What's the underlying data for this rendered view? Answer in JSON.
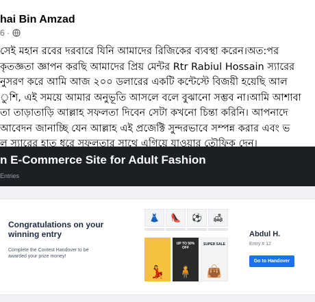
{
  "post": {
    "author": "hai Bin Amzad",
    "time": "6 ·",
    "globe_icon": "globe-icon",
    "lines": [
      "সেই মহান রবের দরবারে যিনি আমাদের রিজিকের ব্যবস্থা করেন।অত:পর",
      "কৃতজ্ঞতা জ্ঞাপন করছি আমাদের প্রিয় মেন্টর Rtr Rabiul Hossain স্যারের",
      "নুসরণ করে আমি আজ ২০০ ডলারের একটি কন্টেস্টে বিজয়ী হয়েছি আল",
      "ুশি, এই সময়ে আমার অনুভূতি আসলে বলে বুঝানো সম্ভব না।আমি আশাবা",
      "তা তাড়াতাড়ি আল্লাহ সফলতা দিবেন সেটা কখনো চিন্তা করিনি। আপনাদে",
      "আবেদন জানাচ্ছি যেন আল্লাহ এই প্রজেক্টি সুন্দরভাবে সম্পন্ন করার  এবং ভ",
      "ল স্যারের হাত ধরে সফলতার সাথে এগিয়ে যাওয়ার তৌফিক দেন।"
    ]
  },
  "attachment": {
    "banner_title": "n E-Commerce Site for Adult Fashion",
    "banner_sub": "Entries",
    "congrats_title": "Congratulations on your winning entry",
    "congrats_sub": "Complete the Contest Handover to be awarded your prize money!",
    "winner_name": "Abdul H.",
    "winner_entry": "Entry # 12",
    "handover_button": "Go to Handover",
    "promo": {
      "p2_text": "UP TO 50% OFF",
      "p3_text": "SUPER SALE"
    }
  },
  "colors": {
    "banner_bg": "#1c1f24",
    "button_blue": "#1a73e8"
  }
}
